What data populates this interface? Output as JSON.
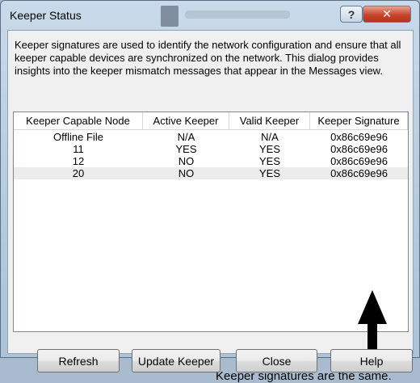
{
  "window": {
    "title": "Keeper Status",
    "help_glyph": "?",
    "close_glyph": "✕"
  },
  "description": "Keeper signatures are used to identify the network configuration and ensure that all keeper capable devices are synchronized on the network. This dialog provides insights into the keeper mismatch messages that appear in the Messages view.",
  "table": {
    "columns": [
      "Keeper Capable Node",
      "Active Keeper",
      "Valid Keeper",
      "Keeper Signature"
    ],
    "rows": [
      [
        "Offline File",
        "N/A",
        "N/A",
        "0x86c69e96"
      ],
      [
        "11",
        "YES",
        "YES",
        "0x86c69e96"
      ],
      [
        "12",
        "NO",
        "YES",
        "0x86c69e96"
      ],
      [
        "20",
        "NO",
        "YES",
        "0x86c69e96"
      ]
    ],
    "selected_row": 3
  },
  "annotation": {
    "text": "Keeper signatures are the same."
  },
  "buttons": {
    "refresh": "Refresh",
    "update_keeper": "Update Keeper",
    "close": "Close",
    "help": "Help"
  }
}
